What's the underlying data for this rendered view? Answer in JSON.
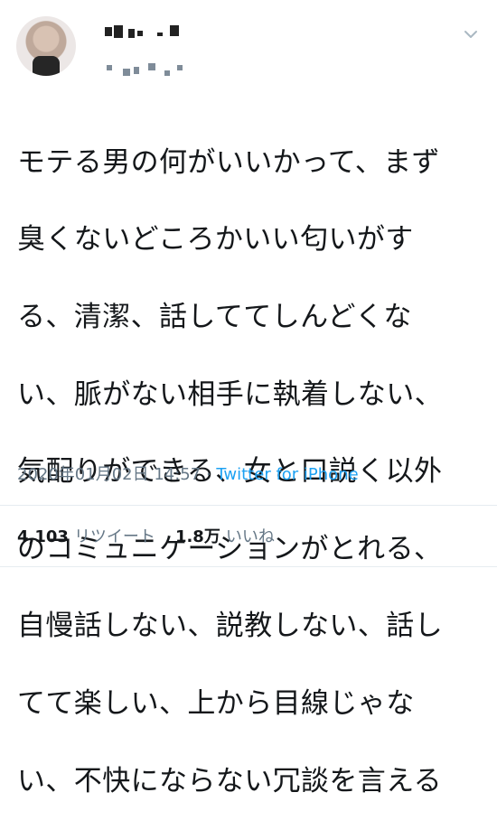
{
  "tweet": {
    "lines": [
      "モテる男の何がいいかって、まず",
      "臭くないどころかいい匂いがす",
      "る、清潔、話しててしんどくな",
      "い、脈がない相手に執着しない、",
      "気配りができる、女と口説く以外",
      "のコミュニケーションがとれる、",
      "自慢話しない、説教しない、話し",
      "てて楽しい、上から目線じゃな",
      "い、不快にならない冗談を言える"
    ],
    "timestamp": "2020年01月02日 14:57",
    "separator": " · ",
    "source": "Twitter for iPhone"
  },
  "stats": {
    "retweets_count": "4,103",
    "retweets_label": "リツイート",
    "likes_count": "1.8万",
    "likes_label": "いいね"
  },
  "colors": {
    "text": "#14171a",
    "meta": "#657786",
    "link": "#1da1f2",
    "divider": "#e6ecf0"
  },
  "icons": {
    "menu": "chevron-down-icon"
  }
}
